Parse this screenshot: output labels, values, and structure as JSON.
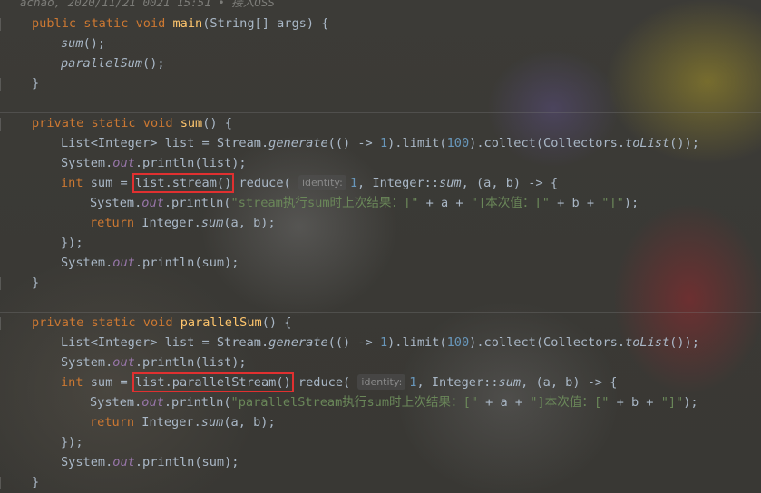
{
  "author_line": "achao, 2020/11/21 0021 15:51 • 接入OSS",
  "main": {
    "l1": {
      "kw": "public static void ",
      "name": "main",
      "rest": "(String[] args) {"
    },
    "l2": {
      "call": "sum",
      "rest": "();"
    },
    "l3": {
      "call": "parallelSum",
      "rest": "();"
    },
    "l4": "}"
  },
  "sum_method": {
    "l1": {
      "kw": "private static void ",
      "name": "sum",
      "rest": "() {"
    },
    "l2": {
      "a": "List<Integer> list = Stream.",
      "gen": "generate",
      "b": "(() -> ",
      "n1": "1",
      "c": ").limit(",
      "n2": "100",
      "d": ").collect(Collectors.",
      "tolist": "toList",
      "e": "());"
    },
    "l3": {
      "a": "System.",
      "out": "out",
      "b": ".println(list);"
    },
    "l4": {
      "kw": "int",
      "a": " sum = ",
      "boxed": "list.stream()",
      "b": " reduce( ",
      "hint": "identity:",
      "n": "1",
      "c": ", Integer::",
      "ref": "sum",
      "d": ", (a, b) -> {"
    },
    "l5": {
      "a": "System.",
      "out": "out",
      "b": ".println(",
      "s1": "\"stream执行sum时上次结果：[\"",
      "c": " + a + ",
      "s2": "\"]本次值：[\"",
      "d": " + b + ",
      "s3": "\"]\"",
      "e": ");"
    },
    "l6": {
      "kw": "return",
      "a": " Integer.",
      "call": "sum",
      "b": "(a, b);"
    },
    "l7": "});",
    "l8": {
      "a": "System.",
      "out": "out",
      "b": ".println(sum);"
    },
    "l9": "}"
  },
  "parallel_method": {
    "l1": {
      "kw": "private static void ",
      "name": "parallelSum",
      "rest": "() {"
    },
    "l2": {
      "a": "List<Integer> list = Stream.",
      "gen": "generate",
      "b": "(() -> ",
      "n1": "1",
      "c": ").limit(",
      "n2": "100",
      "d": ").collect(Collectors.",
      "tolist": "toList",
      "e": "());"
    },
    "l3": {
      "a": "System.",
      "out": "out",
      "b": ".println(list);"
    },
    "l4": {
      "kw": "int",
      "a": " sum = ",
      "boxed": "list.parallelStream()",
      "b": " reduce( ",
      "hint": "identity:",
      "n": "1",
      "c": ", Integer::",
      "ref": "sum",
      "d": ", (a, b) -> {"
    },
    "l5": {
      "a": "System.",
      "out": "out",
      "b": ".println(",
      "s1": "\"parallelStream执行sum时上次结果：[\"",
      "c": " + a + ",
      "s2": "\"]本次值：[\"",
      "d": " + b + ",
      "s3": "\"]\"",
      "e": ");"
    },
    "l6": {
      "kw": "return",
      "a": " Integer.",
      "call": "sum",
      "b": "(a, b);"
    },
    "l7": "});",
    "l8": {
      "a": "System.",
      "out": "out",
      "b": ".println(sum);"
    },
    "l9": "}"
  },
  "colors": {
    "keyword": "#cc7832",
    "method": "#ffc66d",
    "string": "#6a8759",
    "number": "#6897bb",
    "field": "#9876aa",
    "text": "#a9b7c6",
    "highlight_box": "#e03030"
  }
}
